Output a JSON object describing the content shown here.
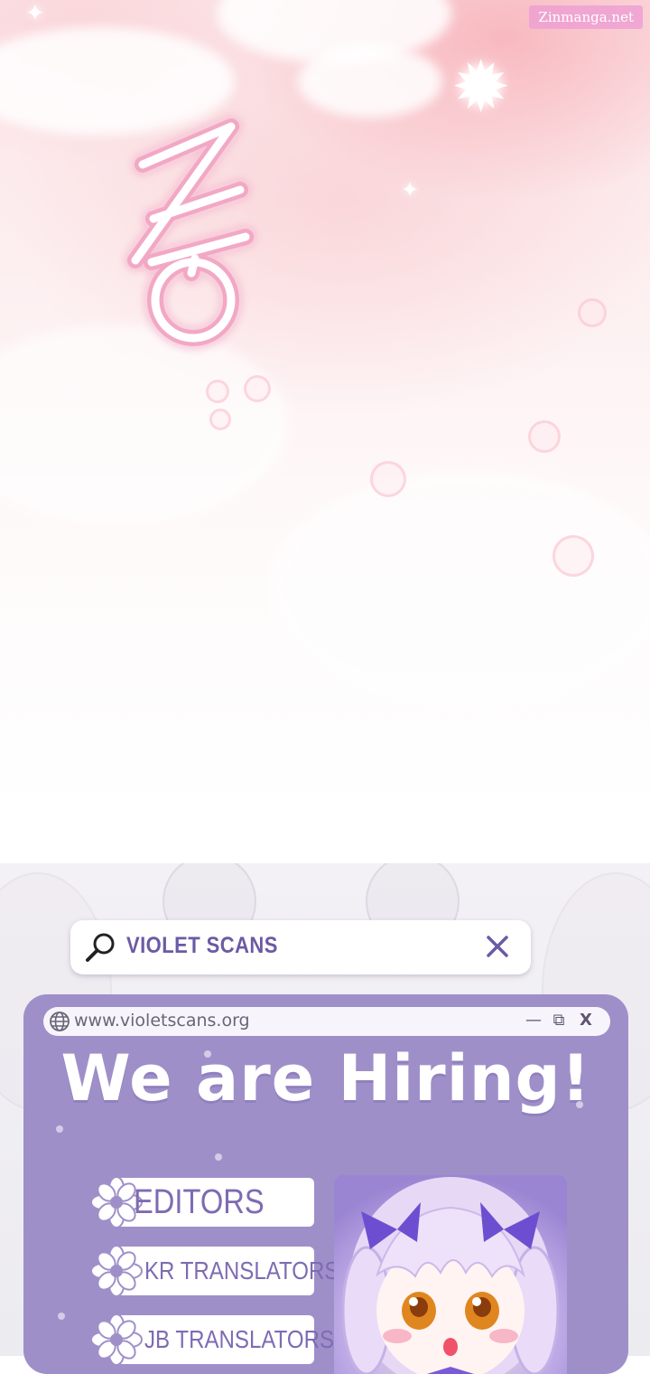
{
  "watermark": "Zinmanga.net",
  "search": {
    "text": "VIOLET SCANS",
    "icon": "search-icon",
    "close_icon": "close-icon"
  },
  "browser": {
    "url": "www.violetscans.org",
    "controls": [
      "minimize-icon",
      "restore-icon",
      "close-icon"
    ],
    "minimize": "—",
    "restore": "⧉",
    "close": "X"
  },
  "headline": "We are Hiring!",
  "roles": [
    {
      "label": "EDITORS"
    },
    {
      "label": "KR TRANSLATORS"
    },
    {
      "label": "JB TRANSLATORS"
    }
  ],
  "colors": {
    "accent_purple": "#9f8fc9",
    "text_purple": "#6b5aa4",
    "sfx_pink": "#f2a8c4"
  }
}
